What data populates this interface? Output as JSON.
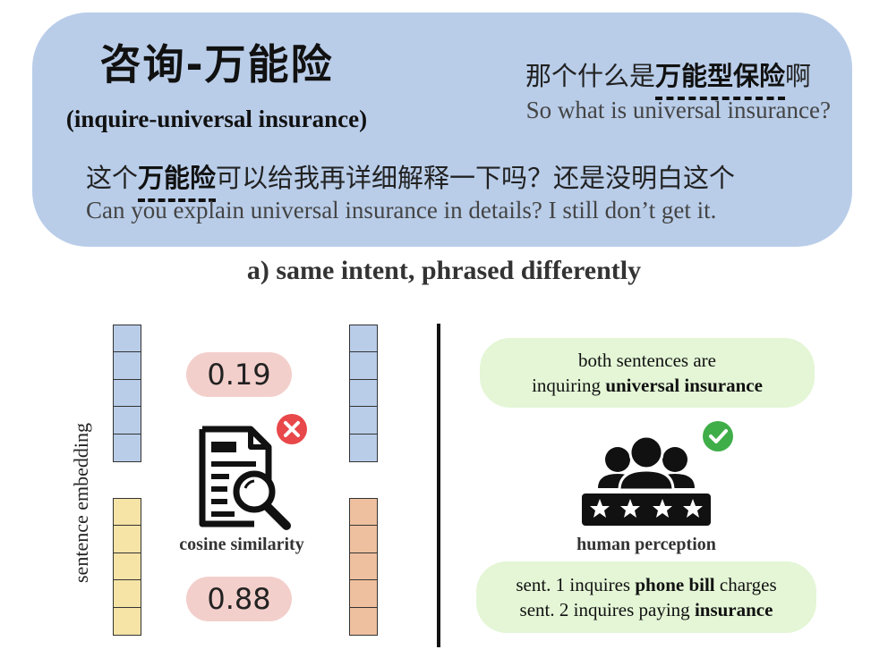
{
  "top": {
    "intent_cn": "咨询-万能险",
    "intent_en": "(inquire-universal insurance)",
    "s1_cn_pre": "那个什么是",
    "s1_cn_kw": "万能型保险",
    "s1_cn_post": "啊",
    "s1_en": "So what is universal insurance?",
    "s2_cn_pre": "这个",
    "s2_cn_kw": "万能险",
    "s2_cn_post": "可以给我再详细解释一下吗？还是没明白这个",
    "s2_en": "Can you explain universal insurance in details? I still don’t get it."
  },
  "caption_a": "a) same intent, phrased differently",
  "left": {
    "axis_label": "sentence embedding",
    "score_top": "0.19",
    "score_bottom": "0.88",
    "tool_label": "cosine similarity",
    "colors": {
      "blue": "#b9cde9",
      "yellow": "#f6e3a6",
      "orange": "#efc09f",
      "error": "#e8484a"
    }
  },
  "right": {
    "bubble1_line1": "both sentences are",
    "bubble1_line2_pre": "inquiring ",
    "bubble1_line2_bold": "universal insurance",
    "person_label": "human perception",
    "bubble2_line1_pre": "sent. 1 inquires ",
    "bubble2_line1_bold": "phone bill",
    "bubble2_line1_post": " charges",
    "bubble2_line2_pre": "sent. 2 inquires paying ",
    "bubble2_line2_bold": "insurance",
    "colors": {
      "bubble": "#e4f6d6",
      "check": "#3fae49"
    }
  }
}
